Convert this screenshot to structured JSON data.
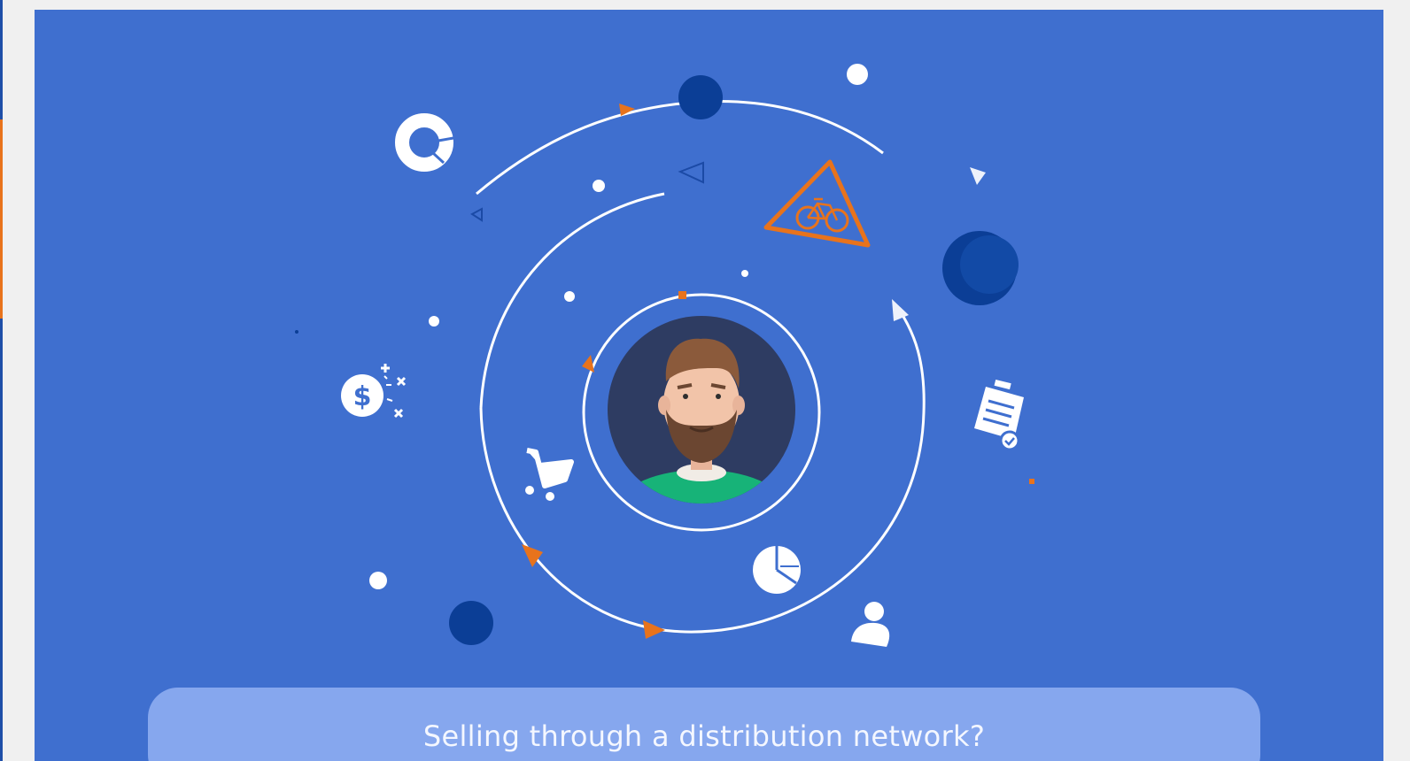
{
  "banner": {
    "question": "Selling through a distribution network?"
  },
  "colors": {
    "page_background": "#f0f0f0",
    "panel_blue": "#3f6fcf",
    "banner_blue": "#86a7ee",
    "navy": "#0b3e96",
    "accent_orange": "#e8731c",
    "white": "#ffffff"
  },
  "icons": [
    "donut-chart-icon",
    "dollar-coin-icon",
    "shopping-cart-icon",
    "pie-chart-icon",
    "user-icon",
    "checklist-document-icon",
    "bicycle-warning-icon",
    "customer-avatar"
  ]
}
